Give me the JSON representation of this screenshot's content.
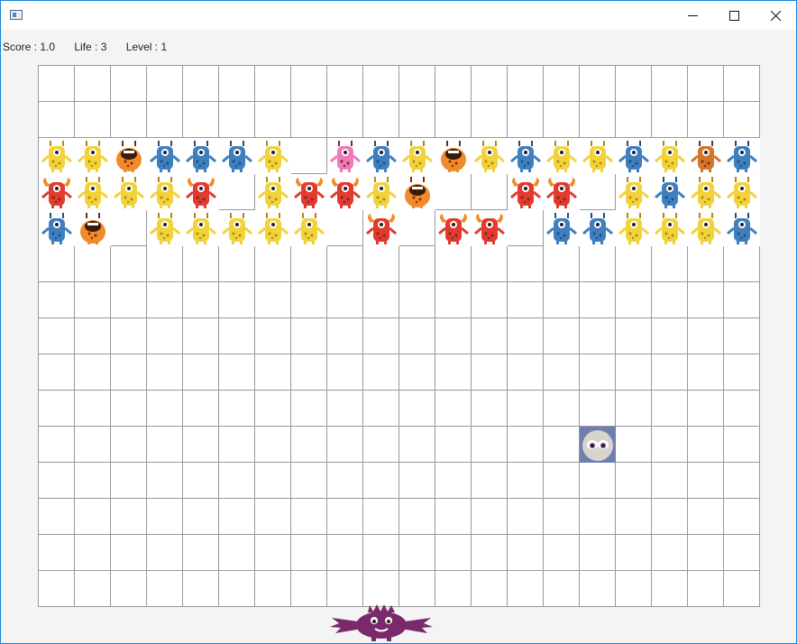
{
  "window": {
    "title": ""
  },
  "hud": {
    "score": "Score : 1.0",
    "life": "Life : 3",
    "level": "Level : 1"
  },
  "board": {
    "cols": 20,
    "rows": 15,
    "rows_of_monsters_start": 2,
    "monster_rows": [
      [
        "yellow",
        "yellow",
        "orange",
        "blue",
        "blue",
        "blue",
        "yellow",
        null,
        "pink",
        "blue",
        "yellow",
        "orange",
        "yellow",
        "blue",
        "yellow",
        "yellow",
        "blue",
        "yellow",
        "brown",
        "blue"
      ],
      [
        "red",
        "yellow",
        "yellow",
        "yellow",
        "red",
        null,
        "yellow",
        "red",
        "red",
        "yellow",
        "orange",
        null,
        null,
        "red",
        "red",
        null,
        "yellow",
        "blue",
        "yellow",
        "yellow"
      ],
      [
        "blue",
        "orange",
        null,
        "yellow",
        "yellow",
        "yellow",
        "yellow",
        "yellow",
        null,
        "red",
        null,
        "red",
        "red",
        null,
        "blue",
        "blue",
        "yellow",
        "yellow",
        "yellow",
        "blue"
      ]
    ],
    "ball_cell": {
      "col": 15,
      "row": 10
    }
  },
  "colors": {
    "yellow": "#f2d23a",
    "blue": "#3f7fbf",
    "orange": "#f08a2a",
    "red": "#e23a2e",
    "pink": "#f07ab8",
    "brown": "#d4762a",
    "paddle": "#7a2a6a",
    "grid": "#9a9a9a"
  },
  "icons": {
    "app": "app-icon",
    "minimize": "minimize-icon",
    "maximize": "maximize-icon",
    "close": "close-icon"
  }
}
